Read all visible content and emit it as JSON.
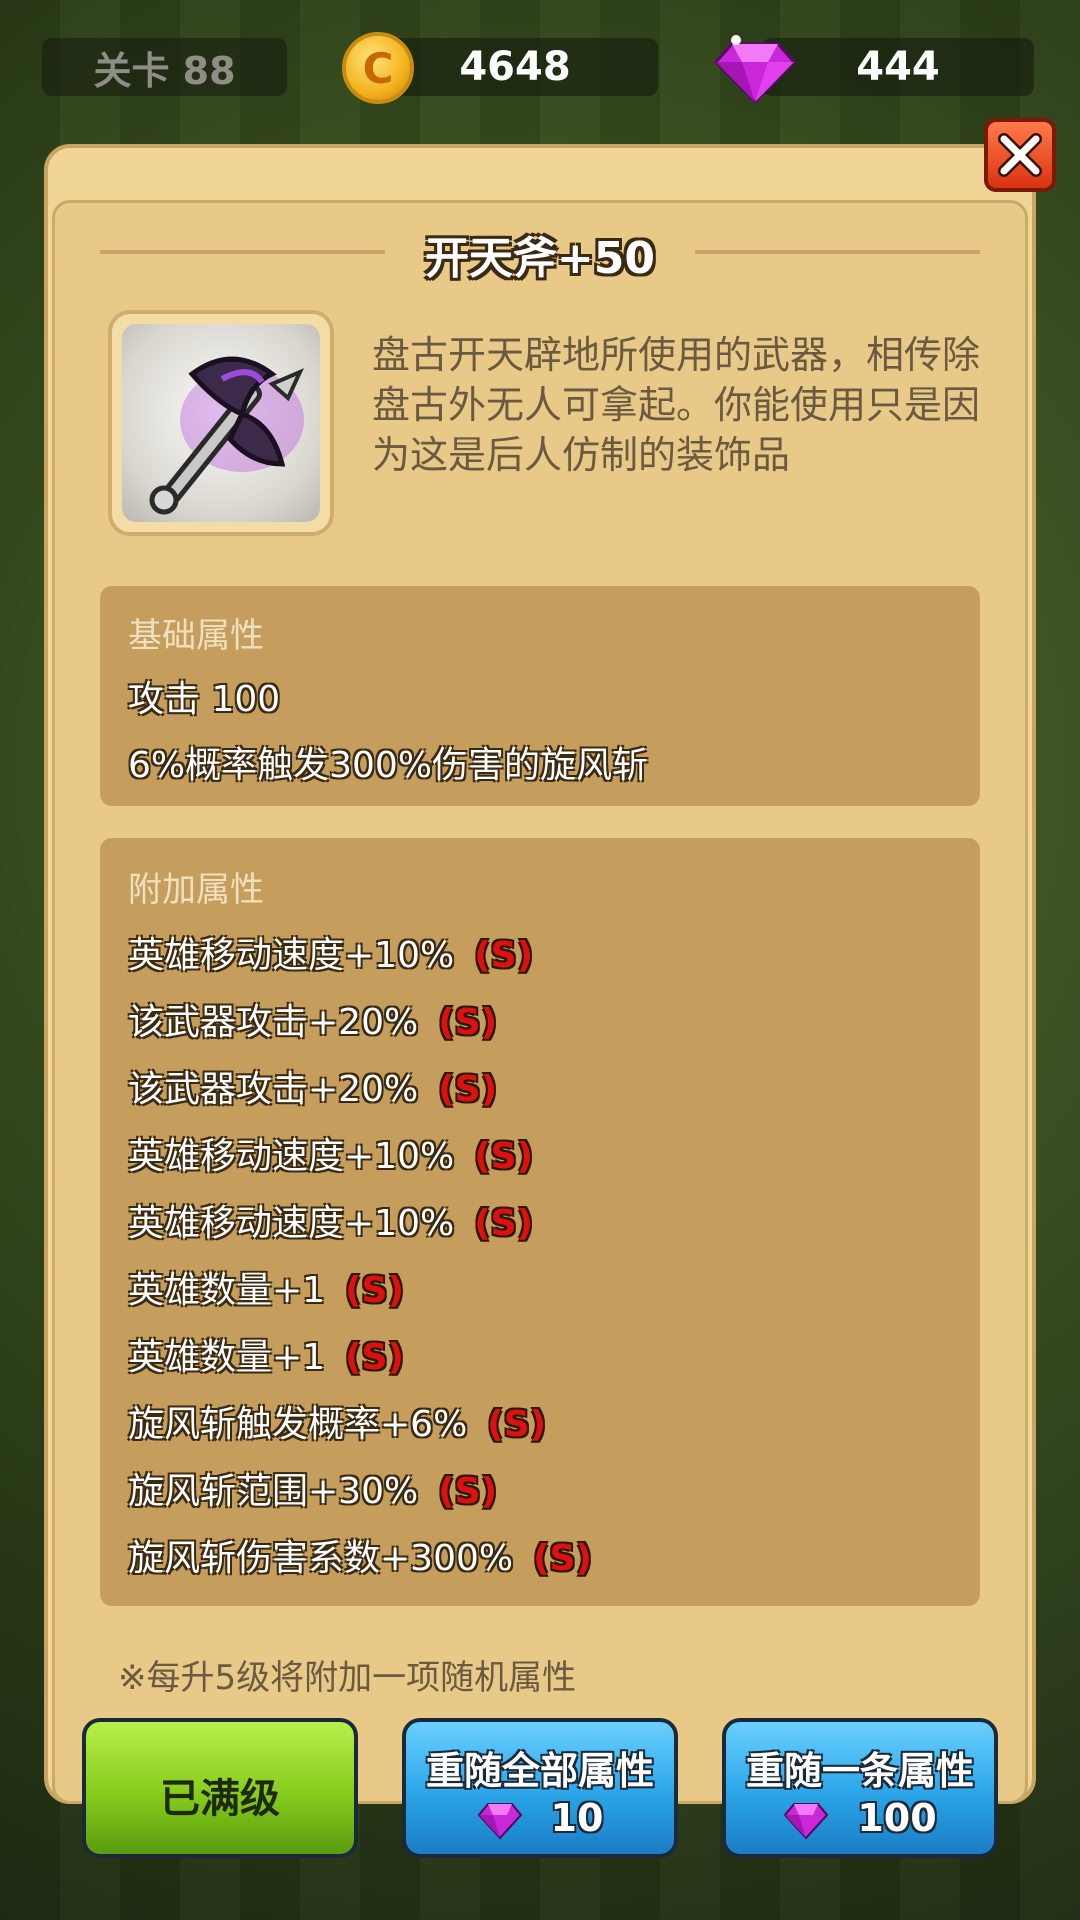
{
  "topbar": {
    "level_label": "关卡 88",
    "coin_symbol": "C",
    "coins": "4648",
    "gems": "444"
  },
  "panel": {
    "title": "开天斧+50",
    "description": "盘古开天辟地所使用的武器，相传除盘古外无人可拿起。你能使用只是因为这是后人仿制的装饰品",
    "base_attributes": {
      "header": "基础属性",
      "lines": [
        "攻击 100",
        "6%概率触发300%伤害的旋风斩"
      ]
    },
    "extra_attributes": {
      "header": "附加属性",
      "grade_tag": "(S)",
      "lines": [
        "英雄移动速度+10%",
        "该武器攻击+20%",
        "该武器攻击+20%",
        "英雄移动速度+10%",
        "英雄移动速度+10%",
        "英雄数量+1",
        "英雄数量+1",
        "旋风斩触发概率+6%",
        "旋风斩范围+30%",
        "旋风斩伤害系数+300%"
      ]
    },
    "note": "※每升5级将附加一项随机属性"
  },
  "buttons": {
    "max_level_label": "已满级",
    "reroll_all_label": "重随全部属性",
    "reroll_all_cost": "10",
    "reroll_one_label": "重随一条属性",
    "reroll_one_cost": "100"
  },
  "colors": {
    "panel_bg": "#f0d596",
    "attr_box": "#c59d5d",
    "grade_s": "#e01010",
    "button_green": "#86cc1c",
    "button_blue": "#2aa5e8",
    "close_red": "#d93312"
  }
}
